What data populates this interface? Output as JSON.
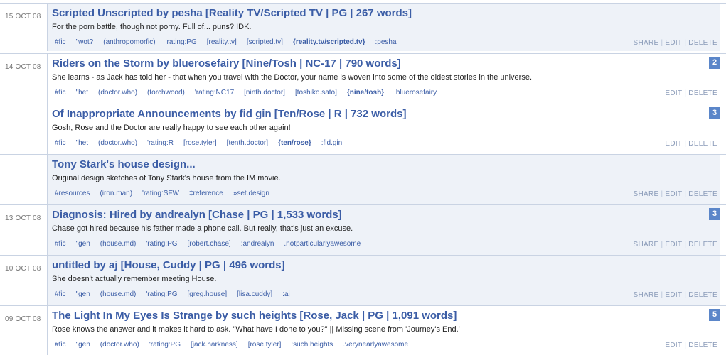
{
  "entries": [
    {
      "date": "15 OCT 08",
      "title": "Scripted Unscripted by pesha [Reality TV/Scripted TV | PG | 267 words]",
      "description": "For the porn battle, though not porny. Full of... puns? IDK.",
      "tags": [
        {
          "text": "#fic",
          "bold": false
        },
        {
          "text": "\"wot?",
          "bold": false
        },
        {
          "text": "(anthropomorfic)",
          "bold": false
        },
        {
          "text": "'rating:PG",
          "bold": false
        },
        {
          "text": "[reality.tv]",
          "bold": false
        },
        {
          "text": "[scripted.tv]",
          "bold": false
        },
        {
          "text": "{reality.tv/scripted.tv}",
          "bold": true
        },
        {
          "text": ":pesha",
          "bold": false
        }
      ],
      "actions": [
        "SHARE",
        "EDIT",
        "DELETE"
      ],
      "badge": ""
    },
    {
      "date": "14 OCT 08",
      "title": "Riders on the Storm by bluerosefairy [Nine/Tosh | NC-17 | 790 words]",
      "description": "She learns - as Jack has told her - that when you travel with the Doctor, your name is woven into some of the oldest stories in the universe.",
      "tags": [
        {
          "text": "#fic",
          "bold": false
        },
        {
          "text": "\"het",
          "bold": false
        },
        {
          "text": "(doctor.who)",
          "bold": false
        },
        {
          "text": "(torchwood)",
          "bold": false
        },
        {
          "text": "'rating:NC17",
          "bold": false
        },
        {
          "text": "[ninth.doctor]",
          "bold": false
        },
        {
          "text": "[toshiko.sato]",
          "bold": false
        },
        {
          "text": "{nine/tosh}",
          "bold": true
        },
        {
          "text": ":bluerosefairy",
          "bold": false
        }
      ],
      "actions": [
        "EDIT",
        "DELETE"
      ],
      "badge": "2"
    },
    {
      "date": "",
      "title": "Of Inappropriate Announcements by fid gin [Ten/Rose | R | 732 words]",
      "description": "Gosh, Rose and the Doctor are really happy to see each other again!",
      "tags": [
        {
          "text": "#fic",
          "bold": false
        },
        {
          "text": "\"het",
          "bold": false
        },
        {
          "text": "(doctor.who)",
          "bold": false
        },
        {
          "text": "'rating:R",
          "bold": false
        },
        {
          "text": "[rose.tyler]",
          "bold": false
        },
        {
          "text": "[tenth.doctor]",
          "bold": false
        },
        {
          "text": "{ten/rose}",
          "bold": true
        },
        {
          "text": ":fid.gin",
          "bold": false
        }
      ],
      "actions": [
        "EDIT",
        "DELETE"
      ],
      "badge": "3"
    },
    {
      "date": "",
      "title": "Tony Stark's house design...",
      "description": "Original design sketches of Tony Stark's house from the IM movie.",
      "tags": [
        {
          "text": "#resources",
          "bold": false
        },
        {
          "text": "(iron.man)",
          "bold": false
        },
        {
          "text": "'rating:SFW",
          "bold": false
        },
        {
          "text": "‡reference",
          "bold": false
        },
        {
          "text": "»set.design",
          "bold": false
        }
      ],
      "actions": [
        "SHARE",
        "EDIT",
        "DELETE"
      ],
      "badge": ""
    },
    {
      "date": "13 OCT 08",
      "title": "Diagnosis: Hired by andrealyn [Chase | PG | 1,533 words]",
      "description": "Chase got hired because his father made a phone call. But really, that's just an excuse.",
      "tags": [
        {
          "text": "#fic",
          "bold": false
        },
        {
          "text": "\"gen",
          "bold": false
        },
        {
          "text": "(house.md)",
          "bold": false
        },
        {
          "text": "'rating:PG",
          "bold": false
        },
        {
          "text": "[robert.chase]",
          "bold": false
        },
        {
          "text": ":andrealyn",
          "bold": false
        },
        {
          "text": ".notparticularlyawesome",
          "bold": false
        }
      ],
      "actions": [
        "SHARE",
        "EDIT",
        "DELETE"
      ],
      "badge": "3"
    },
    {
      "date": "10 OCT 08",
      "title": "untitled by aj [House, Cuddy | PG | 496 words]",
      "description": "She doesn't actually remember meeting House.",
      "tags": [
        {
          "text": "#fic",
          "bold": false
        },
        {
          "text": "\"gen",
          "bold": false
        },
        {
          "text": "(house.md)",
          "bold": false
        },
        {
          "text": "'rating:PG",
          "bold": false
        },
        {
          "text": "[greg.house]",
          "bold": false
        },
        {
          "text": "[lisa.cuddy]",
          "bold": false
        },
        {
          "text": ":aj",
          "bold": false
        }
      ],
      "actions": [
        "SHARE",
        "EDIT",
        "DELETE"
      ],
      "badge": ""
    },
    {
      "date": "09 OCT 08",
      "title": "The Light In My Eyes Is Strange by such heights [Rose, Jack | PG | 1,091 words]",
      "description": "Rose knows the answer and it makes it hard to ask. \"What have I done to you?\" || Missing scene from 'Journey's End.'",
      "tags": [
        {
          "text": "#fic",
          "bold": false
        },
        {
          "text": "\"gen",
          "bold": false
        },
        {
          "text": "(doctor.who)",
          "bold": false
        },
        {
          "text": "'rating:PG",
          "bold": false
        },
        {
          "text": "[jack.harkness]",
          "bold": false
        },
        {
          "text": "[rose.tyler]",
          "bold": false
        },
        {
          "text": ":such.heights",
          "bold": false
        },
        {
          "text": ".verynearlyawesome",
          "bold": false
        }
      ],
      "actions": [
        "EDIT",
        "DELETE"
      ],
      "badge": "5"
    }
  ]
}
